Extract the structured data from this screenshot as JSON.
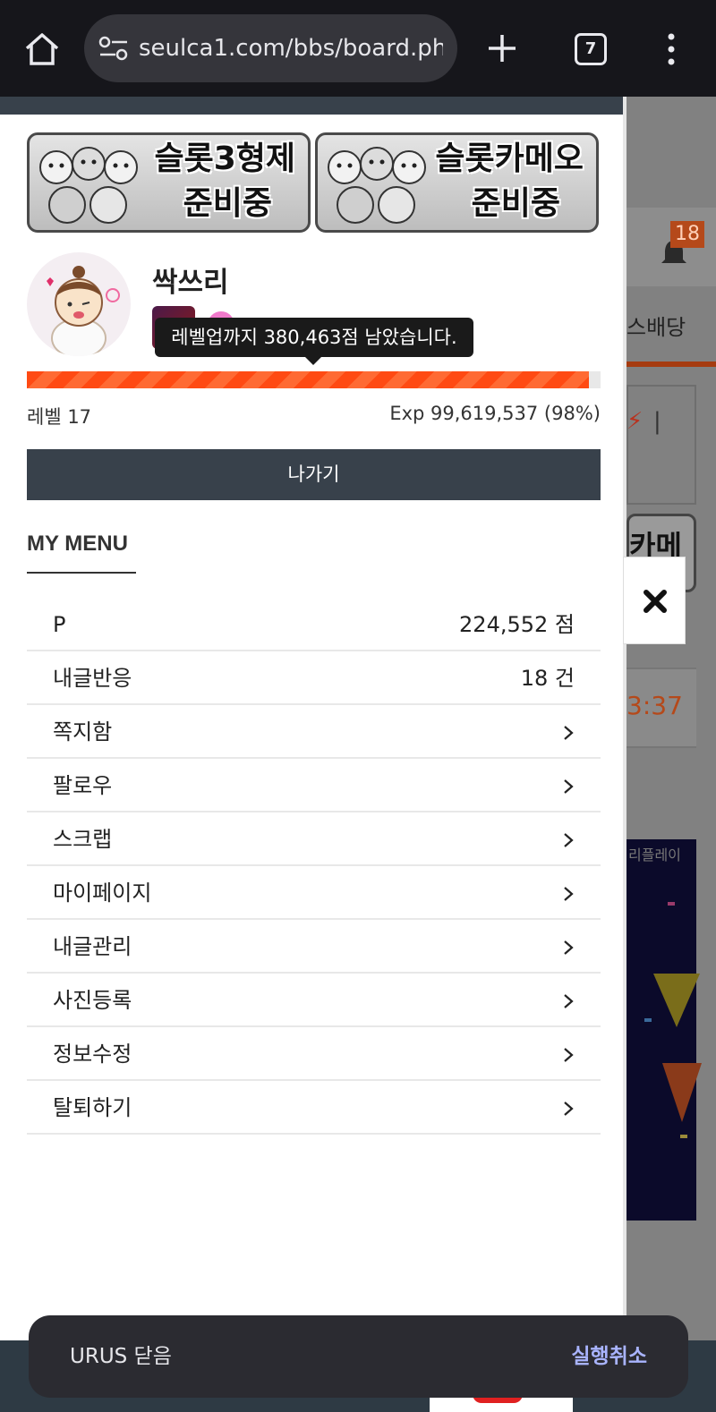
{
  "browser": {
    "url": "seulca1.com/bbs/board.php",
    "tab_count": "7"
  },
  "background_page": {
    "notification_count": "18",
    "tab_label_fragment": "스배당",
    "banner_fragment": "카메오",
    "time_fragment": "3:37",
    "promo_title_fragment": "리플레이"
  },
  "drawer": {
    "banners": [
      {
        "line1": "슬롯3형제",
        "line2": "준비중"
      },
      {
        "line1": "슬롯카메오",
        "line2": "준비중"
      }
    ],
    "profile": {
      "nickname": "싹쓰리",
      "tooltip": "레벨업까지 380,463점 남았습니다.",
      "level_label": "레벨 17",
      "exp_label": "Exp 99,619,537 (98%)",
      "exp_percent": 98
    },
    "logout_label": "나가기",
    "my_menu_title": "MY MENU",
    "menu_items": [
      {
        "label": "P",
        "value": "224,552 점"
      },
      {
        "label": "내글반응",
        "value": "18 건"
      },
      {
        "label": "쪽지함"
      },
      {
        "label": "팔로우"
      },
      {
        "label": "스크랩"
      },
      {
        "label": "마이페이지"
      },
      {
        "label": "내글관리"
      },
      {
        "label": "사진등록"
      },
      {
        "label": "정보수정"
      },
      {
        "label": "탈퇴하기"
      }
    ]
  },
  "snackbar": {
    "message": "URUS 닫음",
    "action": "실행취소"
  },
  "colors": {
    "accent_orange": "#ff4a13",
    "dark_slate": "#38414b",
    "snackbar_action": "#a9b4ff"
  }
}
